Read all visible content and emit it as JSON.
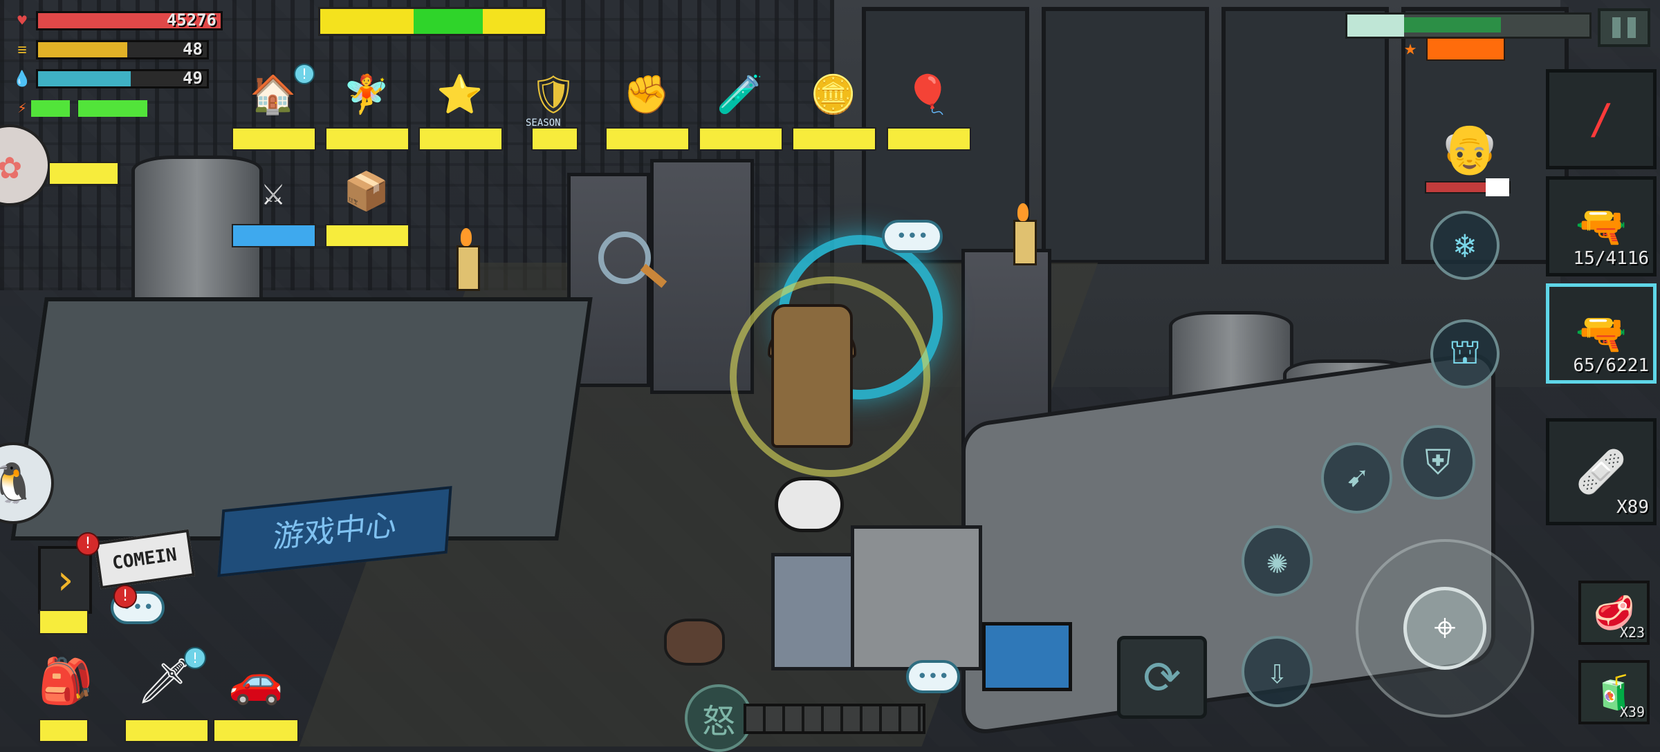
{
  "player": {
    "hp": "45276",
    "food": "48",
    "water": "49"
  },
  "features": [
    {
      "name": "home",
      "icon": "🏠",
      "label": ""
    },
    {
      "name": "fairy",
      "icon": "🧚",
      "label": ""
    },
    {
      "name": "rank-badge",
      "icon": "⭐",
      "label": ""
    },
    {
      "name": "season-pass",
      "icon": "🛡",
      "label": ""
    },
    {
      "name": "fist-event",
      "icon": "✊",
      "label": ""
    },
    {
      "name": "vial",
      "icon": "🧪",
      "label": ""
    },
    {
      "name": "gold-coins",
      "icon": "🪙",
      "label": ""
    },
    {
      "name": "gift-balloons",
      "icon": "🎈",
      "label": ""
    },
    {
      "name": "weapon-armory",
      "icon": "⚔",
      "label": ""
    },
    {
      "name": "supply-crate",
      "icon": "📦",
      "label": ""
    }
  ],
  "season_text": "SEASON",
  "weapons": {
    "smg_ammo": "15/4116",
    "rifle_ammo": "65/6221"
  },
  "items": {
    "medkit_count": "X89",
    "meat_count": "X23",
    "potion_count": "X39"
  },
  "signs": {
    "comein": "COMEIN",
    "game_center": "游戏中心"
  },
  "rage_label": "怒",
  "alerts": {
    "exclaim": "!"
  },
  "colors": {
    "hp": "#e04848",
    "food": "#e2b227",
    "water": "#3fb1c4",
    "energy": "#52e43a",
    "placeholder": "#f7ec3c",
    "accent_cyan": "#5fd6e8"
  }
}
